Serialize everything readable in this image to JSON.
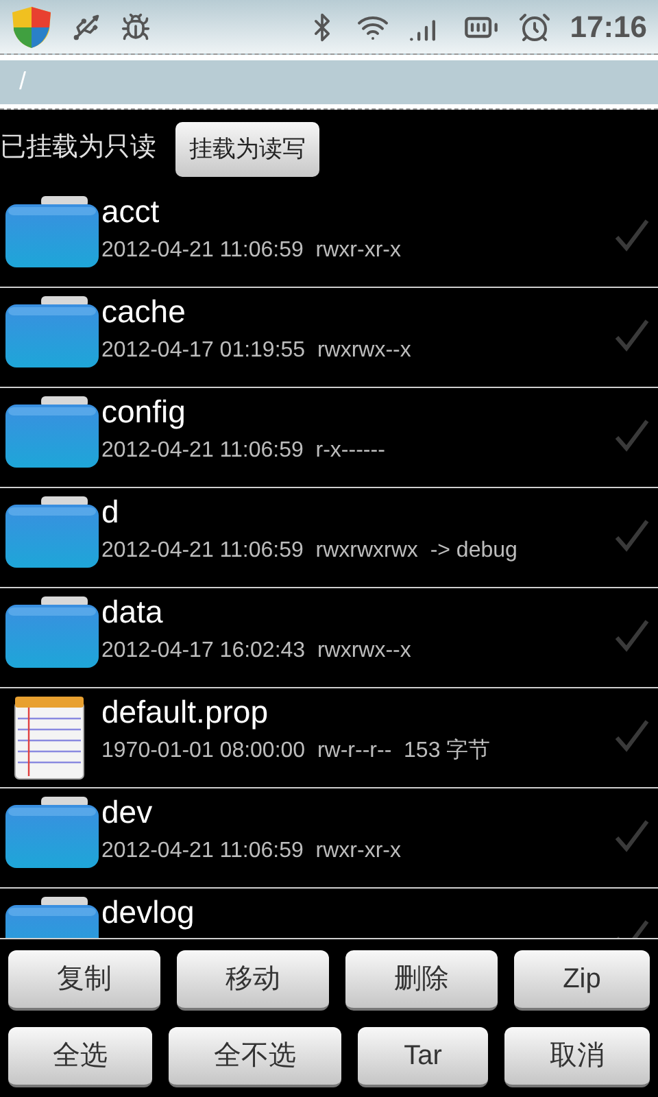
{
  "status_bar": {
    "time": "17:16"
  },
  "path": "/",
  "mount": {
    "status": "已挂载为只读",
    "button": "挂载为读写"
  },
  "files": [
    {
      "kind": "folder",
      "name": "acct",
      "meta": "2012-04-21 11:06:59  rwxr-xr-x",
      "checked": false
    },
    {
      "kind": "folder",
      "name": "cache",
      "meta": "2012-04-17 01:19:55  rwxrwx--x",
      "checked": false
    },
    {
      "kind": "folder",
      "name": "config",
      "meta": "2012-04-21 11:06:59  r-x------",
      "checked": false
    },
    {
      "kind": "folder",
      "name": "d",
      "meta": "2012-04-21 11:06:59  rwxrwxrwx  -> debug",
      "checked": false
    },
    {
      "kind": "folder",
      "name": "data",
      "meta": "2012-04-17 16:02:43  rwxrwx--x",
      "checked": false
    },
    {
      "kind": "file",
      "name": "default.prop",
      "meta": "1970-01-01 08:00:00  rw-r--r--  153 字节",
      "checked": false
    },
    {
      "kind": "folder",
      "name": "dev",
      "meta": "2012-04-21 11:06:59  rwxr-xr-x",
      "checked": false
    },
    {
      "kind": "folder",
      "name": "devlog",
      "checked": false
    }
  ],
  "actions": [
    [
      "复制",
      "移动",
      "删除",
      "Zip"
    ],
    [
      "全选",
      "全不选",
      "Tar",
      "取消"
    ]
  ]
}
